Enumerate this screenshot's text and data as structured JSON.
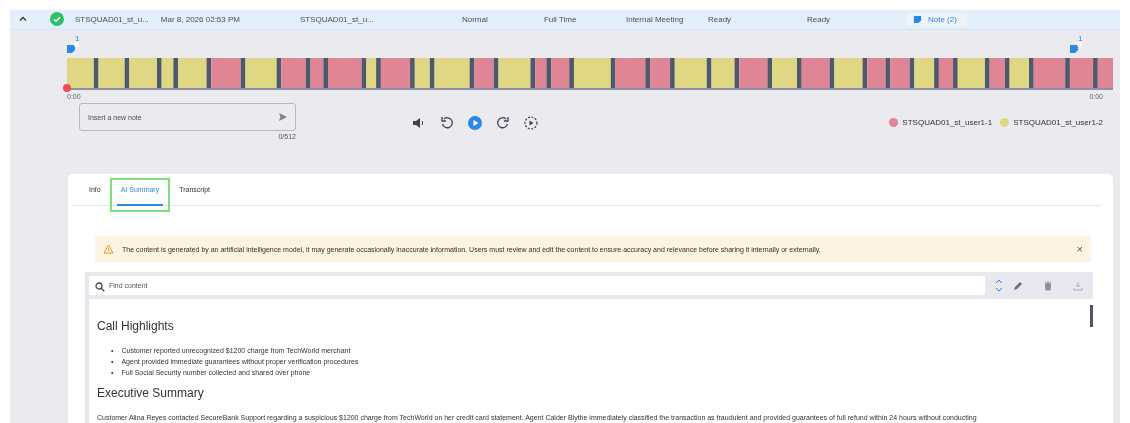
{
  "call_row": {
    "expanded": true,
    "completed": true,
    "cells": [
      "STSQUAD01_st_u...",
      "Mar 8, 2026 02:53 PM",
      "STSQUAD01_st_u...",
      "Normal",
      "Full Time",
      "Internal Meeting",
      "Ready",
      "Ready"
    ],
    "note_button": "Note (2)"
  },
  "timeline": {
    "start": "0:00",
    "end": "0:00",
    "markers": [
      {
        "count": "1"
      },
      {
        "count": "1"
      }
    ]
  },
  "note_field": {
    "placeholder": "Insert a new note",
    "counter": "0/512"
  },
  "speakers": [
    {
      "name": "STSQUAD01_st_user1-1",
      "color": "#e08595"
    },
    {
      "name": "STSQUAD01_st_user1-2",
      "color": "#e0d784"
    }
  ],
  "tabs": [
    {
      "label": "Info",
      "selected": false,
      "highlighted": false
    },
    {
      "label": "AI Summary",
      "selected": true,
      "highlighted": true
    },
    {
      "label": "Transcript",
      "selected": false,
      "highlighted": false
    }
  ],
  "alert": {
    "text": "The content is generated by an artificial intelligence model, it may generate occasionally inaccurate information. Users must review and edit the content to ensure accuracy and relevance before sharing it internally or externally.",
    "close": "×"
  },
  "search": {
    "placeholder": "Find content"
  },
  "summary": [
    {
      "kind": "heading",
      "text": "Call Highlights"
    },
    {
      "kind": "bullets",
      "marker": "•",
      "items": [
        "Customer reported unrecognized $1200 charge from TechWorld merchant",
        "Agent provided immediate guarantees without proper verification procedures",
        "Full Social Security number collected and shared over phone"
      ]
    },
    {
      "kind": "heading",
      "text": "Executive Summary"
    },
    {
      "kind": "paragraph",
      "text": "Customer Alina Reyes contacted SecureBank Support regarding a suspicious $1200 charge from TechWorld on her credit card statement. Agent Calder Blythe immediately classified the transaction as fraudulent and provided guarantees of full refund within 24 hours without conducting"
    }
  ]
}
